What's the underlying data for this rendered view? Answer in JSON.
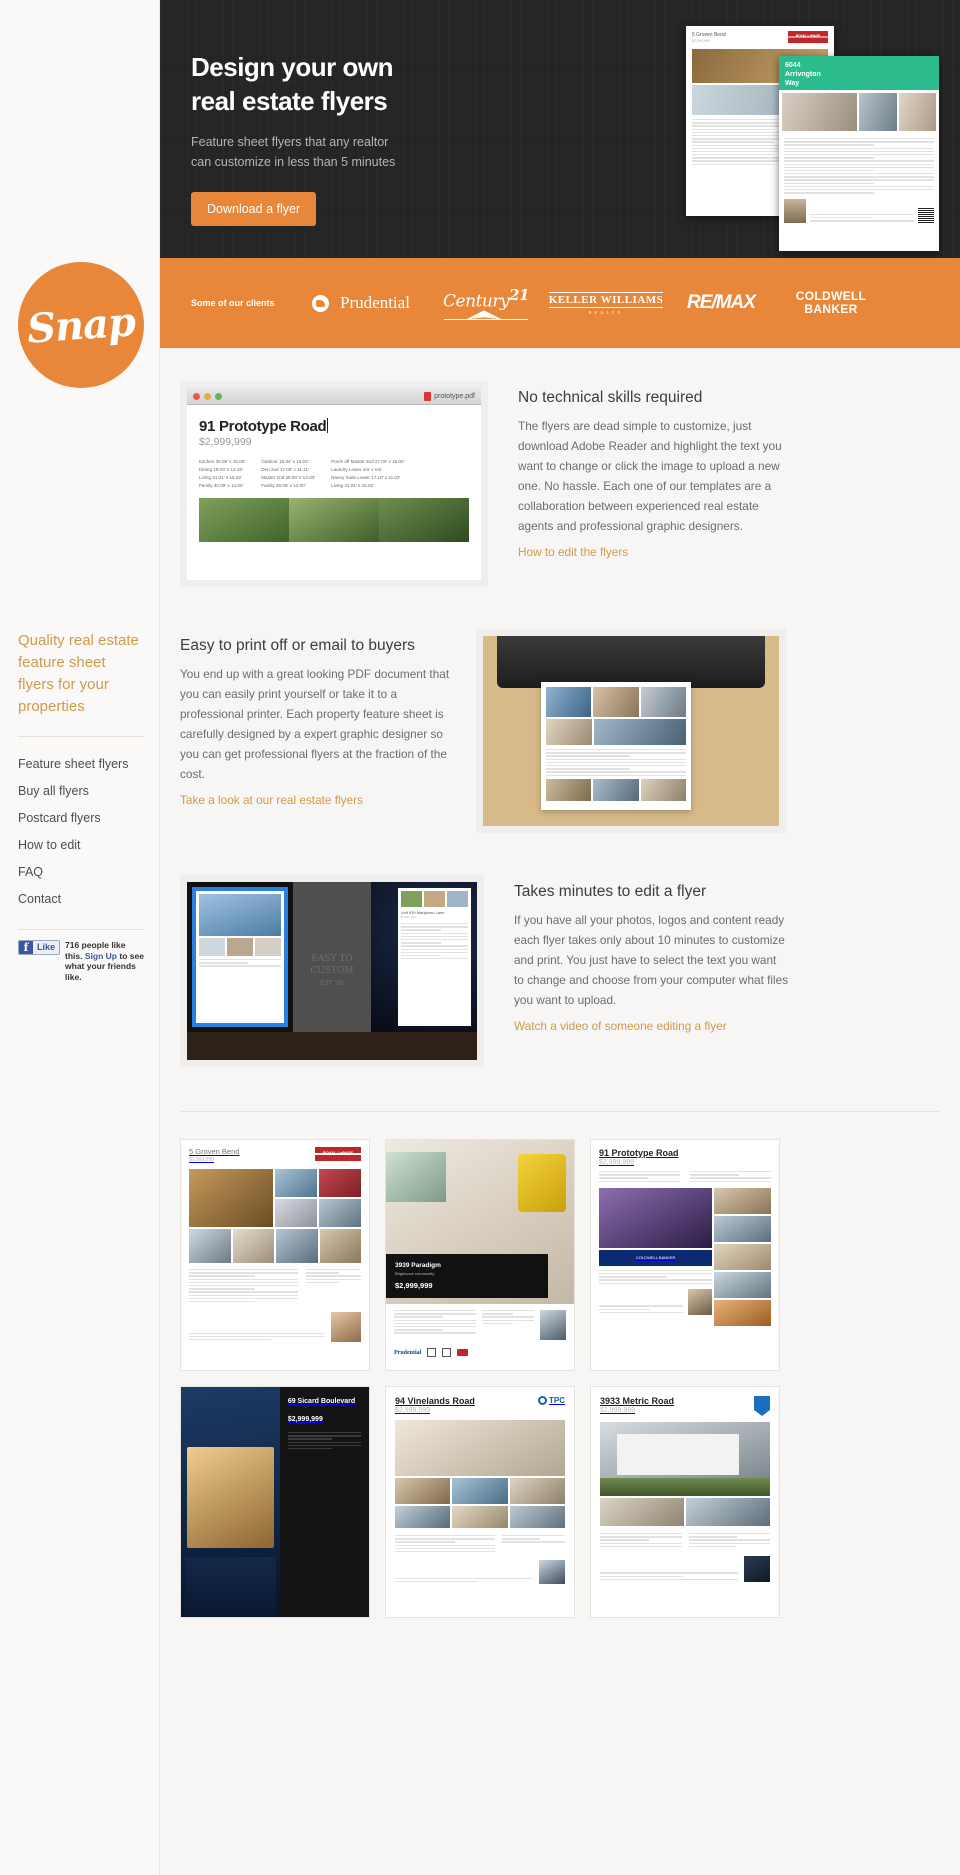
{
  "brand": {
    "logo_text": "Snap"
  },
  "hero": {
    "title_line1": "Design your own",
    "title_line2": "real estate flyers",
    "subtitle_line1": "Feature sheet flyers that any realtor",
    "subtitle_line2": "can customize in less than 5 minutes",
    "cta_label": "Download a flyer",
    "flyer_a_title": "5 Groven Bend",
    "flyer_a_price": "$2,999,999",
    "flyer_b_title_line1": "6044",
    "flyer_b_title_line2": "Arrivngton",
    "flyer_b_title_line3": "Way",
    "flyer_a_logo": "ROYAL LePAGE"
  },
  "clients": {
    "label": "Some of our clients",
    "logos": [
      {
        "name": "Prudential",
        "text": "Prudential"
      },
      {
        "name": "Century 21",
        "text": "Century",
        "sup": "21"
      },
      {
        "name": "Keller Williams",
        "text": "KELLER WILLIAMS",
        "sub": "REALTY"
      },
      {
        "name": "RE/MAX",
        "text": "RE/MAX"
      },
      {
        "name": "Coldwell Banker",
        "line1": "COLDWELL",
        "line2": "BANKER"
      }
    ]
  },
  "sections": [
    {
      "heading": "No technical skills required",
      "body": "The flyers are dead simple to customize, just download Adobe Reader and highlight the text you want to change or click the image to upload a new one. No hassle. Each one of our templates are a collaboration between experienced real estate agents and professional graphic designers.",
      "link": "How to edit the flyers",
      "shot": {
        "filename": "prototype.pdf",
        "doc_title": "91 Prototype Road",
        "doc_price": "$2,999,999",
        "specs_left": [
          "Kitchen 30.05' x 15.00'",
          "Dining  18.03' x 12.10'",
          "Living  31.01' x 15.02'",
          "Family  30.09' x 14.00'"
        ],
        "specs_right": [
          "Outdoor  15.04' x 15.02'",
          "Den 2nd 17.00' x 11.11'",
          "Master 2nd 26.00' x 14.03'",
          "Family  30.09' x 14.00'"
        ],
        "specs_far": [
          "Porch off Master 2nd 27.00' x 15.00'",
          "Laundry Lower n/a' x n/a'",
          "Nanny Suite Lower 17.10' x 11.02'",
          "Living  31.01' x 15.02'"
        ]
      }
    },
    {
      "heading": "Easy to print off or email to buyers",
      "body": "You end up with a great looking PDF document that you can easily print yourself or take it to a professional printer. Each property feature sheet is carefully designed by a expert graphic designer so you can get professional flyers at the fraction of the cost.",
      "link": "Take a look at our real estate flyers"
    },
    {
      "heading": "Takes minutes to edit a flyer",
      "body": "If you have all your photos, logos and content ready each flyer takes only about 10 minutes to customize and print. You just have to select the text you want to change and choose from your computer what files you want to upload.",
      "link": "Watch a video of someone editing a flyer",
      "chalk_line1": "EASY TO CUSTOM",
      "chalk_line2": "EST '06",
      "screen_doc_title": "Unit 939 Marlyboro Lane",
      "screen_doc_price": "$2,999,999"
    }
  ],
  "sidebar": {
    "headline": "Quality real estate feature sheet flyers for your properties",
    "nav": [
      {
        "label": "Feature sheet flyers"
      },
      {
        "label": "Buy all flyers"
      },
      {
        "label": "Postcard flyers"
      },
      {
        "label": "How to edit"
      },
      {
        "label": "FAQ"
      },
      {
        "label": "Contact"
      }
    ],
    "facebook": {
      "f_glyph": "f",
      "like_label": "Like",
      "count_text": "716 people like this.",
      "signup_text": "Sign Up",
      "tail_text": "to see what your friends like."
    }
  },
  "gallery": [
    {
      "title": "5 Groven Bend",
      "price": "$2,999,999",
      "logo": "ROYAL LePAGE",
      "style": "light-royal"
    },
    {
      "title": "3939 Paradigm",
      "subtitle": "Brightcove community",
      "price": "$2,999,999",
      "style": "photo-dark-caption"
    },
    {
      "title": "91 Prototype Road",
      "price": "$2,999,999",
      "logo": "COLDWELL BANKER",
      "style": "light-coldwell"
    },
    {
      "title": "69 Sicard Boulevard",
      "price": "$2,999,999",
      "style": "dark-sidebar"
    },
    {
      "title": "94 Vinelands Road",
      "price": "$2,999,999",
      "logo": "TPC",
      "style": "light-tpc"
    },
    {
      "title": "3933 Metric Road",
      "price": "$2,999,999",
      "style": "light-shield"
    }
  ],
  "colors": {
    "accent": "#e8873a",
    "link": "#d09a4e",
    "hero_bg": "#252525",
    "page_bg": "#f7f6f4"
  }
}
